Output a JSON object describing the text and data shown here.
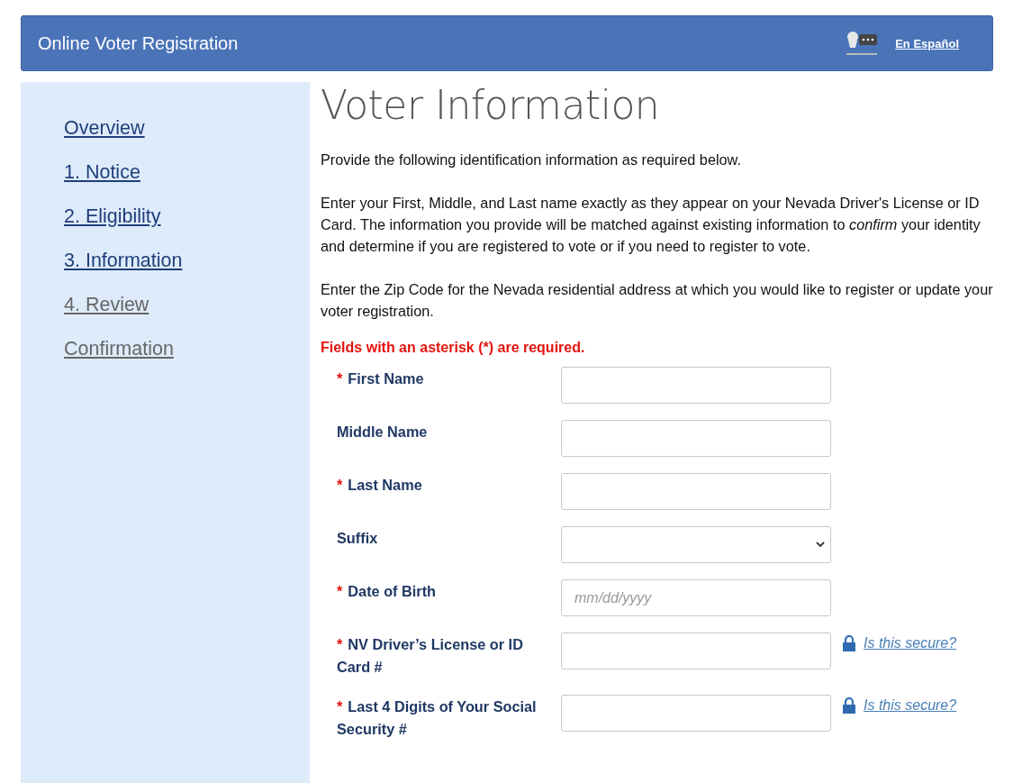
{
  "header": {
    "title": "Online Voter Registration",
    "language_link": "En Español"
  },
  "sidebar": {
    "items": [
      {
        "label": "Overview",
        "disabled": false
      },
      {
        "label": "1. Notice",
        "disabled": false
      },
      {
        "label": "2. Eligibility",
        "disabled": false
      },
      {
        "label": "3. Information",
        "disabled": false
      },
      {
        "label": "4. Review",
        "disabled": true
      },
      {
        "label": "Confirmation",
        "disabled": true
      }
    ]
  },
  "main": {
    "title": "Voter Information",
    "paragraphs": [
      "Provide the following identification information as required below.",
      "Enter your First, Middle, and Last name exactly as they appear on your Nevada Driver's License or ID Card.  The information you provide will be matched against existing information to *confirm* your identity and determine if you are registered to vote or if you need to register to vote.",
      "Enter the Zip Code for the Nevada residential address at which you would like to register or update your voter registration."
    ],
    "required_note": "Fields with an asterisk (*) are required.",
    "fields": [
      {
        "kind": "text",
        "marker": "*",
        "label": "First Name"
      },
      {
        "kind": "text",
        "label": "Middle Name"
      },
      {
        "kind": "text",
        "marker": "*",
        "label": "Last Name"
      },
      {
        "kind": "select",
        "label": "Suffix"
      },
      {
        "kind": "text",
        "marker": "*",
        "label": "Date of Birth",
        "placeholder": "mm/dd/yyyy"
      },
      {
        "kind": "text",
        "marker": "*",
        "label": "NV Driver’s License or ID Card #",
        "secure_link": "Is this secure?"
      },
      {
        "kind": "text",
        "marker": "*",
        "label": "Last 4 Digits of Your Social Security #",
        "secure_link": "Is this secure?"
      }
    ]
  }
}
